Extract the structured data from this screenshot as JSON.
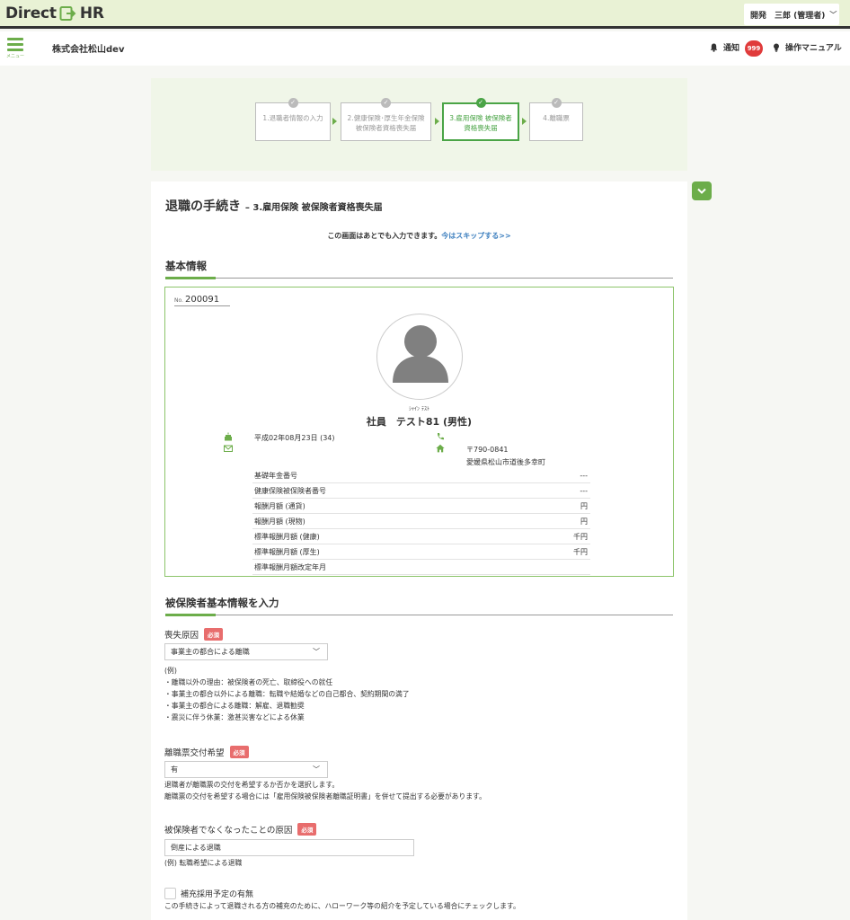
{
  "header": {
    "logo_text_1": "Direct",
    "logo_text_2": "HR",
    "user_menu": "開発　三郎 (管理者)",
    "user_menu_chevron": "﹀"
  },
  "subheader": {
    "menu_label": "メニュー",
    "company": "株式会社松山dev",
    "notify_label": "通知",
    "notify_count": "999",
    "manual_label": "操作マニュアル"
  },
  "steps": [
    {
      "label": "1.退職者情報の入力",
      "active": false
    },
    {
      "label": "2.健康保険･厚生年金保険 被保険者資格喪失届",
      "active": false
    },
    {
      "label": "3.雇用保険 被保険者資格喪失届",
      "active": true
    },
    {
      "label": "4.離職票",
      "active": false
    }
  ],
  "step_check": "✓",
  "collapse_chevron": "⌄",
  "page": {
    "title": "退職の手続き",
    "subtitle": "– 3.雇用保険 被保険者資格喪失届",
    "skip_text": "この画面はあとでも入力できます。",
    "skip_link": "今はスキップする>>"
  },
  "basic_info": {
    "section_title": "基本情報",
    "no_label": "No.",
    "employee_no": "200091",
    "kana": "ｼｬｲﾝ ﾃｽﾄ",
    "name": "社員　テスト81 (男性)",
    "birth": "平成02年08月23日 (34)",
    "postal": "〒790-0841",
    "address": "愛媛県松山市道後多幸町",
    "rows": [
      {
        "label": "基礎年金番号",
        "value": "---"
      },
      {
        "label": "健康保険被保険者番号",
        "value": "---"
      },
      {
        "label": "報酬月額 (通貨)",
        "value": "円"
      },
      {
        "label": "報酬月額 (現物)",
        "value": "円"
      },
      {
        "label": "標準報酬月額 (健康)",
        "value": "千円"
      },
      {
        "label": "標準報酬月額 (厚生)",
        "value": "千円"
      },
      {
        "label": "標準報酬月額改定年月",
        "value": ""
      }
    ]
  },
  "form": {
    "section_title": "被保険者基本情報を入力",
    "required_label": "必須",
    "loss_reason": {
      "label": "喪失原因",
      "value": "事業主の都合による離職",
      "notes": [
        "(例)",
        "・離職以外の理由：被保険者の死亡、取締役への就任",
        "・事業主の都合以外による離職：転職や結婚などの自己都合、契約期間の満了",
        "・事業主の都合による離職：解雇、退職勧奨",
        "・震災に伴う休業：激甚災害などによる休業"
      ]
    },
    "separation_slip": {
      "label": "離職票交付希望",
      "value": "有",
      "notes": [
        "退職者が離職票の交付を希望するか否かを選択します。",
        "離職票の交付を希望する場合には「雇用保険被保険者離職証明書」を併せて提出する必要があります。"
      ]
    },
    "cause": {
      "label": "被保険者でなくなったことの原因",
      "value": "倒産による退職",
      "example": "(例) 転職希望による退職"
    },
    "replacement": {
      "label": "補充採用予定の有無",
      "note": "この手続きによって退職される方の補充のために、ハローワーク等の紹介を予定している場合にチェックします。"
    }
  },
  "colors": {
    "accent": "#6cad4a",
    "active_step": "#4aa446",
    "badge": "#e03b3b",
    "required": "#e86d6d",
    "link": "#3d7fbf"
  }
}
